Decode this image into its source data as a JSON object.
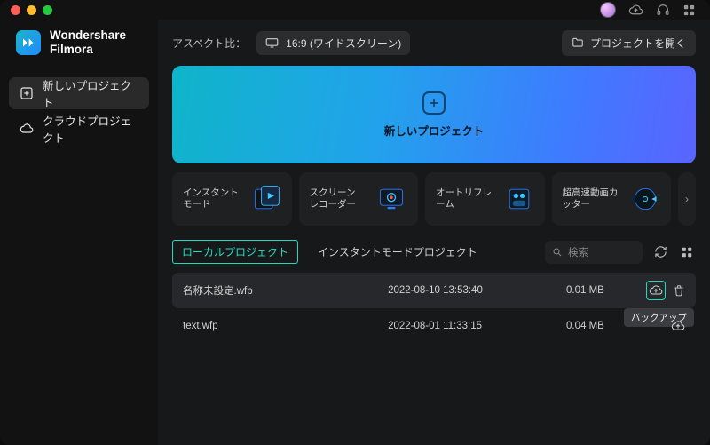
{
  "brand": {
    "line1": "Wondershare",
    "line2": "Filmora"
  },
  "sidebar": {
    "items": [
      {
        "label": "新しいプロジェクト"
      },
      {
        "label": "クラウドプロジェクト"
      }
    ]
  },
  "toolbar": {
    "aspect_label": "アスペクト比：",
    "aspect_value": "16:9 (ワイドスクリーン)",
    "open_project": "プロジェクトを開く"
  },
  "hero": {
    "label": "新しいプロジェクト"
  },
  "cards": [
    {
      "title": "インスタントモード"
    },
    {
      "title": "スクリーン\nレコーダー"
    },
    {
      "title": "オートリフレーム"
    },
    {
      "title": "超高速動画カッター"
    }
  ],
  "tabs": {
    "local": "ローカルプロジェクト",
    "instant": "インスタントモードプロジェクト"
  },
  "search": {
    "placeholder": "検索"
  },
  "projects": [
    {
      "name": "名称未設定.wfp",
      "date": "2022-08-10 13:53:40",
      "size": "0.01 MB"
    },
    {
      "name": "text.wfp",
      "date": "2022-08-01 11:33:15",
      "size": "0.04 MB"
    }
  ],
  "tooltip": {
    "backup": "バックアップ"
  }
}
